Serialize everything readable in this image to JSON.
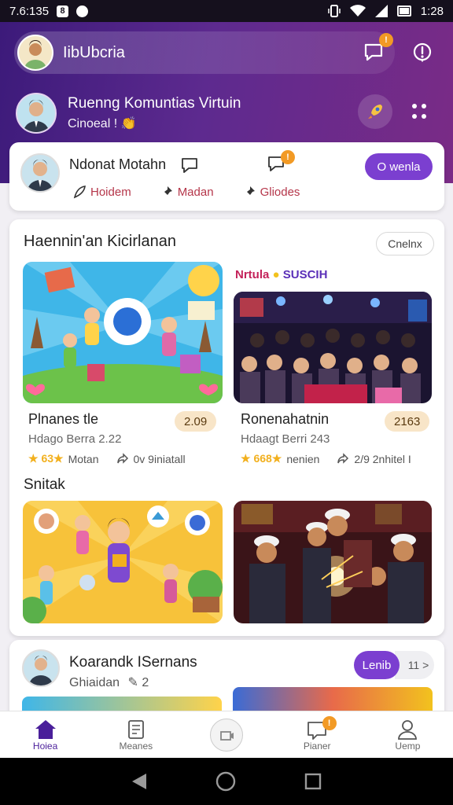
{
  "status_bar": {
    "time_left": "7.6:135",
    "time_right": "1:28"
  },
  "header": {
    "title": "IibUbcria",
    "notification_badge": "!"
  },
  "community": {
    "title": "Ruenng Komuntias Virtuin",
    "subtitle": "Cinoeal !"
  },
  "profile_card": {
    "name": "Ndonat Motahn",
    "notification_badge": "!",
    "follow_label": "O wenla",
    "actions": [
      {
        "label": "Hoidem",
        "icon": "feather-icon"
      },
      {
        "label": "Madan",
        "icon": "pin-icon"
      },
      {
        "label": "Gliodes",
        "icon": "pin-icon"
      }
    ]
  },
  "feed": {
    "section_title": "Haennin'an Kicirlanan",
    "section_button": "Cnelnx",
    "items": [
      {
        "title": "Plnanes tle",
        "subtitle": "Hdago Berra 2.22",
        "count": "2.09",
        "stars": "★ 63★",
        "stat_label": "Motan",
        "share_label": "0v 9iniatall"
      },
      {
        "tag_primary": "Nrtula",
        "tag_secondary": "SUSCIH",
        "title": "Ronenahatnin",
        "subtitle": "Hdaagt Berri 243",
        "count": "2163",
        "stars": "★ 668★",
        "stat_label": "nenien",
        "share_label": "2/9 2nhitel I"
      }
    ],
    "subheading": "Snitak"
  },
  "bottom_card": {
    "title": "Koarandk ISernans",
    "subtitle": "Ghiaidan",
    "count": "2",
    "join_label": "Lenib",
    "next_label": "11 >"
  },
  "bottom_nav": {
    "items": [
      {
        "label": "Hoiea",
        "icon": "home-icon",
        "active": true
      },
      {
        "label": "Meanes",
        "icon": "document-icon",
        "active": false
      },
      {
        "label": "",
        "icon": "create-icon",
        "active": false
      },
      {
        "label": "Pianer",
        "icon": "bookmark-icon",
        "active": false,
        "badge": "!"
      },
      {
        "label": "Uemp",
        "icon": "user-icon",
        "active": false
      }
    ]
  },
  "colors": {
    "accent": "#7b3fd0",
    "header_start": "#3c1a7a",
    "header_end": "#7a2b86",
    "badge": "#f29a25"
  }
}
